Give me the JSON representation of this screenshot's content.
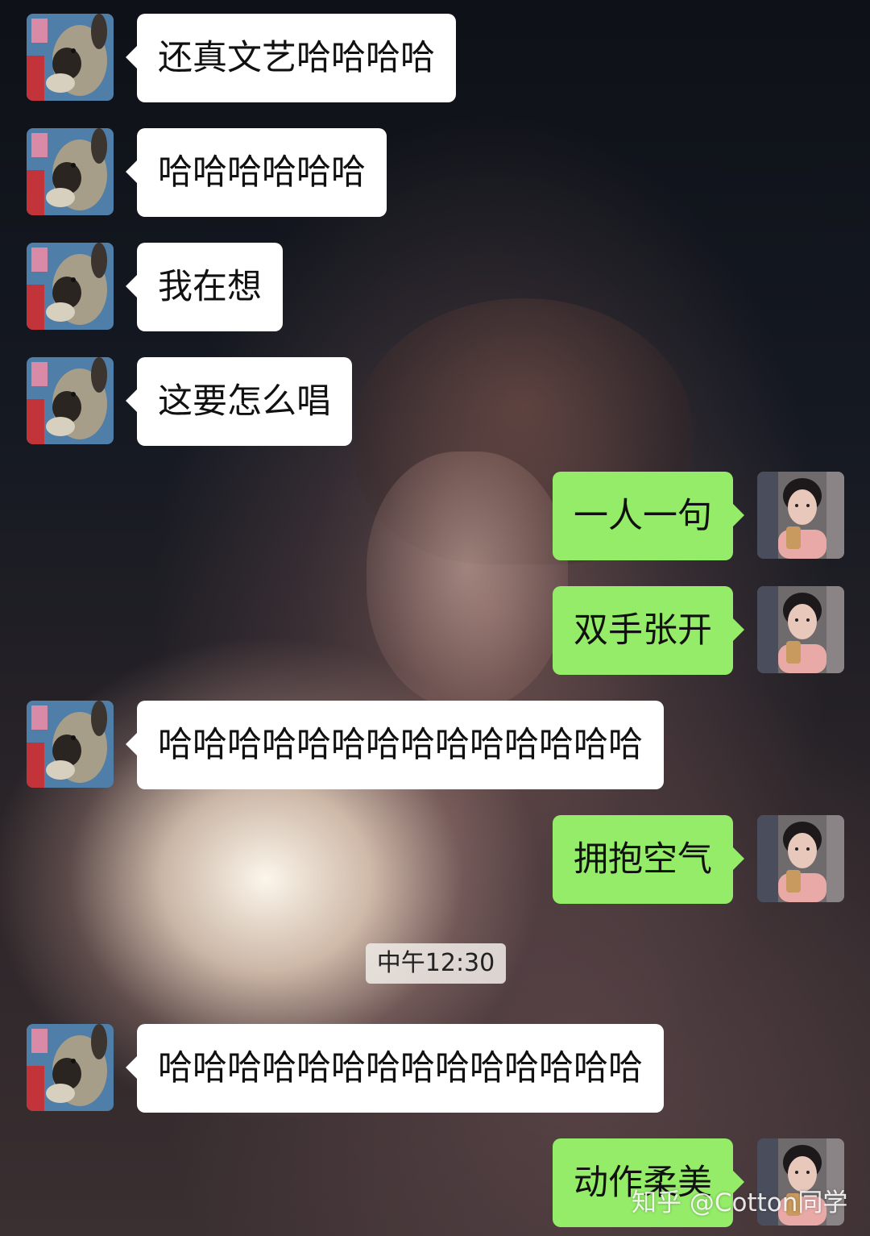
{
  "chat": {
    "messages": [
      {
        "side": "in",
        "text": "还真文艺哈哈哈哈"
      },
      {
        "side": "in",
        "text": "哈哈哈哈哈哈"
      },
      {
        "side": "in",
        "text": "我在想"
      },
      {
        "side": "in",
        "text": "这要怎么唱"
      },
      {
        "side": "out",
        "text": "一人一句"
      },
      {
        "side": "out",
        "text": "双手张开"
      },
      {
        "side": "in",
        "text": "哈哈哈哈哈哈哈哈哈哈哈哈哈哈"
      },
      {
        "side": "out",
        "text": "拥抱空气"
      },
      {
        "side": "in",
        "text": "哈哈哈哈哈哈哈哈哈哈哈哈哈哈"
      },
      {
        "side": "out",
        "text": "动作柔美"
      }
    ],
    "timestamp": "中午12:30"
  },
  "watermark": "知乎 @Cotton同学",
  "icons": {
    "incoming_avatar": "goat-avatar-icon",
    "outgoing_avatar": "woman-avatar-icon"
  },
  "colors": {
    "incoming_bubble": "#ffffff",
    "outgoing_bubble": "#95ec69"
  }
}
